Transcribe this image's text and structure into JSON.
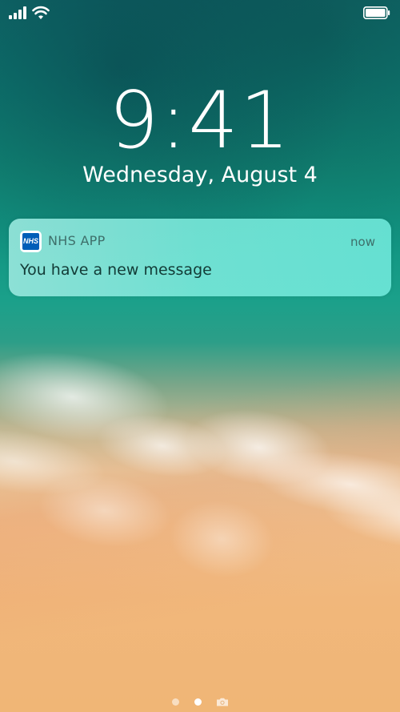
{
  "status_bar": {
    "signal_icon": "cellular-signal-icon",
    "wifi_icon": "wifi-icon",
    "battery_icon": "battery-icon"
  },
  "lock_screen": {
    "time": "9:41",
    "date": "Wednesday, August 4"
  },
  "notification": {
    "app_icon": "nhs-app-icon",
    "app_icon_text": "NHS",
    "app_name": "NHS APP",
    "time": "now",
    "message": "You have a new message"
  },
  "page_indicator": {
    "pages": 3,
    "active_index": 1,
    "camera_icon": "camera-icon"
  },
  "colors": {
    "nhs_blue": "#005eb8",
    "notification_bg": "#7fe8da",
    "text_white": "#ffffff"
  }
}
